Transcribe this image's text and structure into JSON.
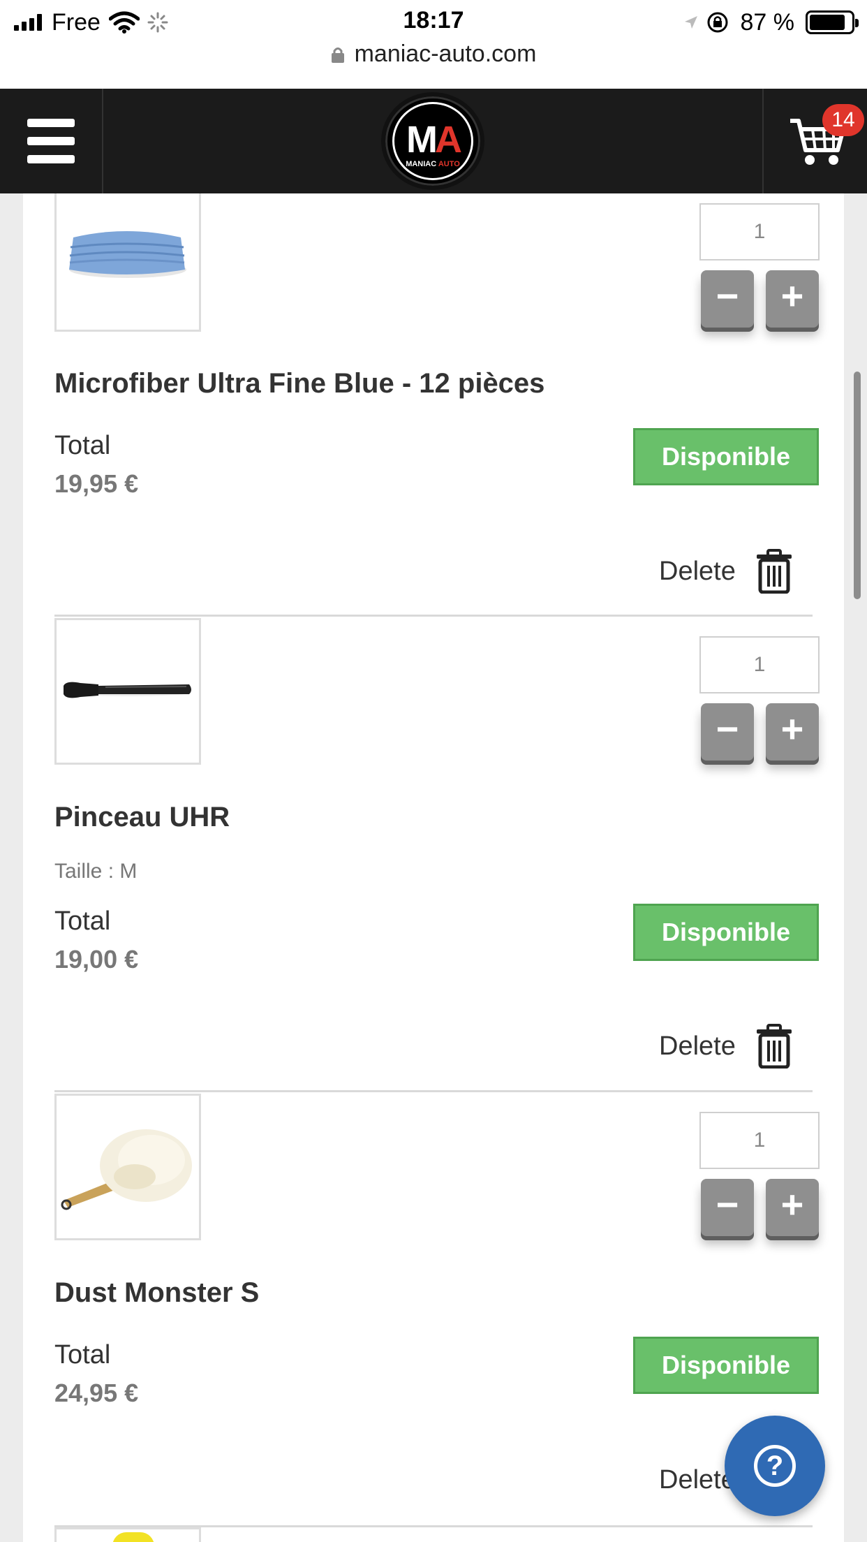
{
  "status_bar": {
    "carrier": "Free",
    "time": "18:17",
    "battery_percent": "87 %",
    "battery_level": 0.87,
    "url": "maniac-auto.com"
  },
  "header": {
    "logo_letters_m": "M",
    "logo_letters_a": "A",
    "logo_sub_1": "MANIAC",
    "logo_sub_2": "AUTO",
    "cart_count": "14"
  },
  "cart_items": [
    {
      "title": "Microfiber Ultra Fine Blue - 12 pièces",
      "option": "",
      "quantity": "1",
      "total_label": "Total",
      "total": "19,95 €",
      "availability": "Disponible",
      "delete_label": "Delete"
    },
    {
      "title": "Pinceau UHR",
      "option": "Taille : M",
      "quantity": "1",
      "total_label": "Total",
      "total": "19,00 €",
      "availability": "Disponible",
      "delete_label": "Delete"
    },
    {
      "title": "Dust Monster S",
      "option": "",
      "quantity": "1",
      "total_label": "Total",
      "total": "24,95 €",
      "availability": "Disponible",
      "delete_label": "Delete"
    }
  ],
  "stepper": {
    "minus": "−",
    "plus": "+"
  },
  "help": {
    "symbol": "?"
  },
  "colors": {
    "header_bg": "#1b1b1b",
    "brand_red": "#e0352b",
    "available_green": "#69c06a",
    "help_blue": "#2f6ab4"
  },
  "icons": [
    "signal-icon",
    "wifi-icon",
    "loading-spinner-icon",
    "location-arrow-icon",
    "rotation-lock-icon",
    "battery-icon",
    "lock-icon",
    "hamburger-menu-icon",
    "cart-icon",
    "minus-icon",
    "plus-icon",
    "trash-icon",
    "help-icon"
  ]
}
